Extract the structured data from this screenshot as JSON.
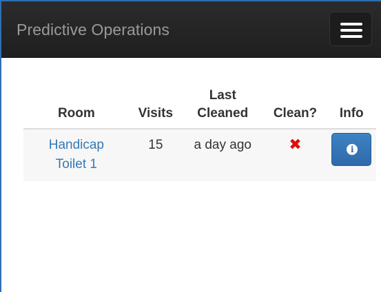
{
  "navbar": {
    "brand": "Predictive Operations",
    "toggle_icon": "hamburger-menu-icon"
  },
  "table": {
    "headers": {
      "room": "Room",
      "visits": "Visits",
      "last_cleaned_line1": "Last",
      "last_cleaned_line2": "Cleaned",
      "clean": "Clean?",
      "info": "Info"
    },
    "rows": [
      {
        "room_line1": "Handicap",
        "room_line2": "Toilet 1",
        "visits": "15",
        "last_cleaned": "a day ago",
        "clean_icon": "red-x-icon",
        "clean_mark": "✖",
        "info_icon": "info-circle-icon",
        "info_glyph": "i"
      }
    ]
  },
  "colors": {
    "navbar_bg": "#222222",
    "brand_text": "#9a9a9a",
    "link": "#3379b7",
    "x_mark": "#e00d0d",
    "info_button": "#337ab7"
  }
}
